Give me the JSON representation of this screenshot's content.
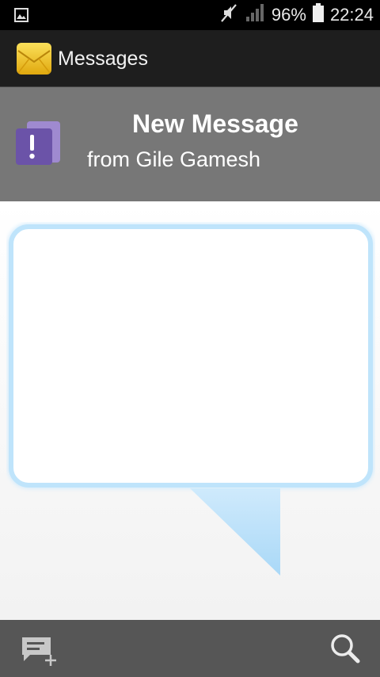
{
  "status_bar": {
    "battery_percent": "96%",
    "time": "22:24",
    "icons": [
      "gallery-icon",
      "mute-icon",
      "signal-icon",
      "battery-icon"
    ]
  },
  "app_bar": {
    "title": "Messages",
    "icon": "messages-envelope-icon"
  },
  "notification": {
    "headline": "New Message",
    "sender_line": "from Gile Gamesh",
    "icon": "alert-message-icon"
  },
  "bubble": {
    "message_text": ""
  },
  "bottom_bar": {
    "icons": [
      "compose-icon",
      "search-icon"
    ]
  },
  "colors": {
    "status_bar_bg": "#000000",
    "app_bar_bg": "#1e1e1e",
    "header_bg": "#777777",
    "bubble_border": "#bfe4fb",
    "bubble_tail": "#b8e0fa",
    "bottom_bar_bg": "#565656",
    "accent_purple": "#7a64b0",
    "envelope_yellow": "#f2c318"
  }
}
